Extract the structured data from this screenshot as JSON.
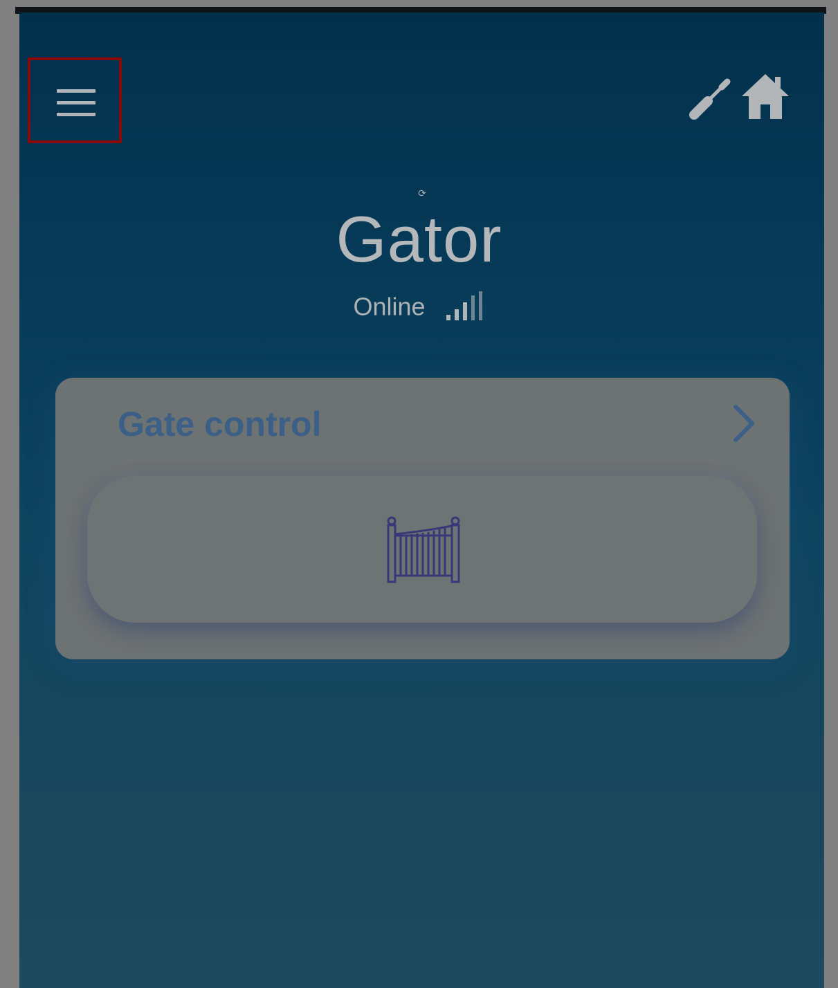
{
  "header": {
    "menu_icon": "hamburger-menu-icon",
    "tool_icon": "screwdriver-icon",
    "home_icon": "home-icon"
  },
  "device": {
    "refresh_icon": "refresh-icon",
    "refresh_glyph": "⟳",
    "name": "Gator",
    "status": "Online",
    "signal_icon": "signal-strength-icon"
  },
  "card": {
    "title": "Gate control",
    "chevron_icon": "chevron-right-icon",
    "gate_button_icon": "gate-icon"
  },
  "colors": {
    "background_top": "#02304b",
    "background_bottom": "#1e4a60",
    "highlight": "#8a0a0a",
    "card_title": "#3b5f86",
    "gate_icon": "#3a3677"
  }
}
